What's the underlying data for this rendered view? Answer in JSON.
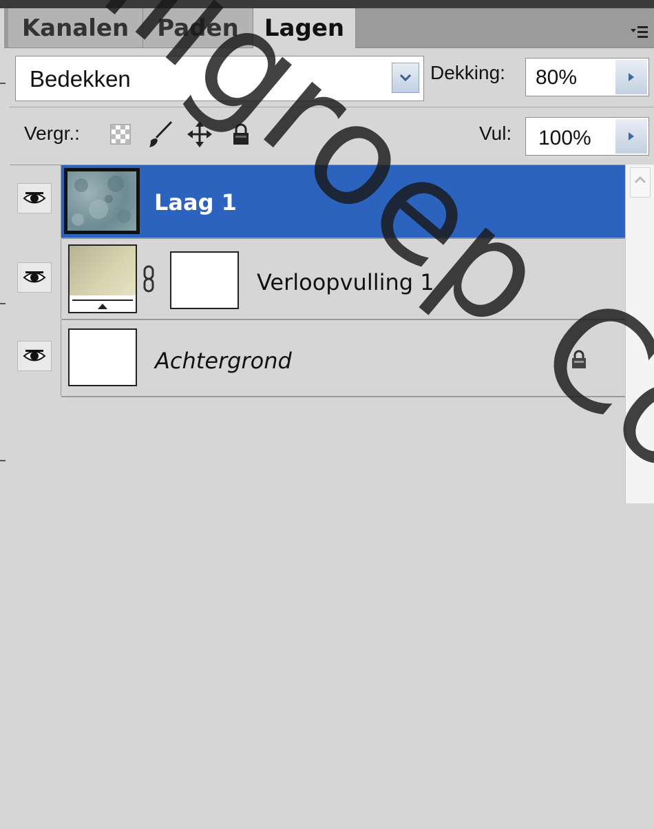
{
  "tabs": [
    {
      "label": "Kanalen",
      "active": false
    },
    {
      "label": "Paden",
      "active": false
    },
    {
      "label": "Lagen",
      "active": true
    }
  ],
  "blend_mode": {
    "value": "Bedekken"
  },
  "opacity": {
    "label": "Dekking:",
    "value": "80%"
  },
  "lock": {
    "label": "Vergr.:"
  },
  "fill": {
    "label": "Vul:",
    "value": "100%"
  },
  "layers": [
    {
      "name": "Laag 1",
      "selected": true,
      "visible": true
    },
    {
      "name": "Verloopvulling 1",
      "selected": false,
      "visible": true
    },
    {
      "name": "Achtergrond",
      "selected": false,
      "visible": true,
      "locked": true
    }
  ],
  "watermark": {
    "text": "naligroep Copyright"
  },
  "colors": {
    "selection": "#2c63bf",
    "panel": "#d6d6d6",
    "tab_inactive": "#b3b3b3"
  },
  "icons": [
    "panel-menu-icon",
    "dropdown-arrow-icon",
    "right-arrow-icon",
    "lock-transparency-icon",
    "lock-brush-icon",
    "lock-move-icon",
    "lock-all-icon",
    "eye-icon",
    "chain-link-icon",
    "padlock-icon",
    "scroll-up-icon"
  ]
}
